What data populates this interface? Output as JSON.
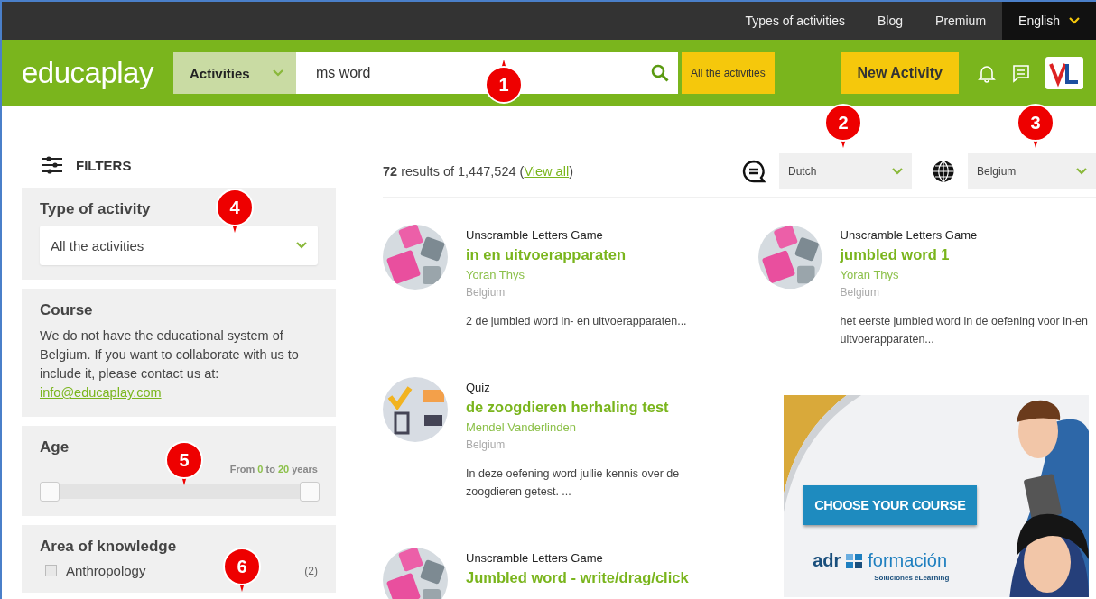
{
  "top_links": [
    {
      "label": "Types of activities",
      "selected": false
    },
    {
      "label": "Blog",
      "selected": false
    },
    {
      "label": "Premium",
      "selected": false
    },
    {
      "label": "English",
      "selected": true
    }
  ],
  "header": {
    "logo": "educaplay",
    "category": "Activities",
    "search_value": "ms word",
    "all_button": "All the activities",
    "new_button": "New Activity"
  },
  "filters": {
    "title": "FILTERS",
    "type_of_activity": {
      "title": "Type of activity",
      "value": "All the activities"
    },
    "course": {
      "title": "Course",
      "text": "We do not have the educational system of Belgium. If you want to collaborate with us to include it, please contact us at:",
      "link": "info@educaplay.com"
    },
    "age": {
      "title": "Age",
      "from_label": "From",
      "from": "0",
      "to_label": "to",
      "to": "20",
      "unit": "years",
      "level": 1
    },
    "area": {
      "title": "Area of knowledge",
      "items": [
        {
          "label": "Anthropology",
          "count": "(2)",
          "checked": false
        }
      ]
    }
  },
  "results_bar": {
    "count": "72",
    "text": "results of 1,447,524",
    "link_open": "(",
    "link": "View all",
    "link_close": ")",
    "language": "Dutch",
    "country": "Belgium"
  },
  "columns": [
    [
      {
        "kind": "letters",
        "type": "Unscramble Letters Game",
        "title": "in en uitvoerapparaten",
        "author": "Yoran Thys",
        "country": "Belgium",
        "description": "2 de jumbled word in- en uitvoerapparaten..."
      },
      {
        "kind": "quiz",
        "type": "Quiz",
        "title": "de zoogdieren herhaling test",
        "author": "Mendel Vanderlinden",
        "country": "Belgium",
        "description": "In deze oefening word jullie kennis over de zoogdieren getest. ..."
      },
      {
        "kind": "letters",
        "type": "Unscramble Letters Game",
        "title": "Jumbled word - write/drag/click"
      }
    ],
    [
      {
        "kind": "letters",
        "type": "Unscramble Letters Game",
        "title": "jumbled word 1",
        "author": "Yoran Thys",
        "country": "Belgium",
        "description": "het eerste jumbled word in de oefening voor in-en uitvoerapparaten..."
      }
    ]
  ],
  "ad": {
    "button": "CHOOSE YOUR COURSE",
    "brand_a": "adr",
    "brand_b": "formación",
    "tagline": "Soluciones eLearning"
  },
  "callouts": [
    {
      "label": "1"
    },
    {
      "label": "2"
    },
    {
      "label": "3"
    },
    {
      "label": "4"
    },
    {
      "label": "5"
    },
    {
      "label": "6"
    }
  ]
}
